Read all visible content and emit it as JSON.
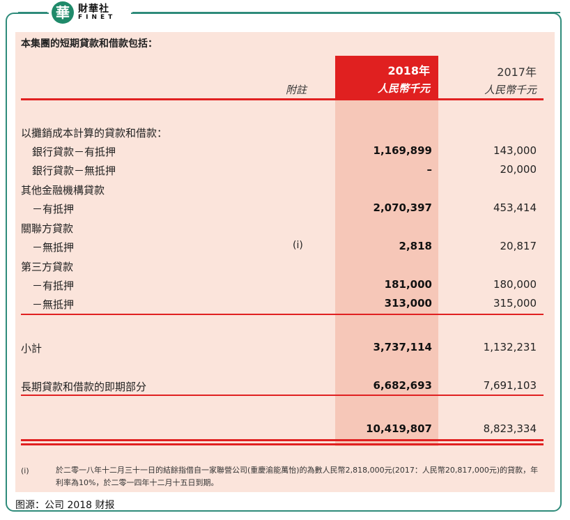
{
  "logo": {
    "mark": "華",
    "name_cn": "財華社",
    "name_en": "FINET"
  },
  "intro": "本集團的短期貸款和借款包括：",
  "columns": {
    "note_header": "附註",
    "current": {
      "year": "2018年",
      "unit": "人民幣千元"
    },
    "prior": {
      "year": "2017年",
      "unit": "人民幣千元"
    }
  },
  "rows": [
    {
      "label": "以攤銷成本計算的貸款和借款：",
      "note": "",
      "v2018": "",
      "v2017": ""
    },
    {
      "label": "銀行貸款－有抵押",
      "note": "",
      "v2018": "1,169,899",
      "v2017": "143,000"
    },
    {
      "label": "銀行貸款－無抵押",
      "note": "",
      "v2018": "–",
      "v2017": "20,000"
    },
    {
      "label": "其他金融機構貸款",
      "note": "",
      "v2018": "",
      "v2017": ""
    },
    {
      "label": "－有抵押",
      "note": "",
      "v2018": "2,070,397",
      "v2017": "453,414"
    },
    {
      "label": "關聯方貸款",
      "note": "",
      "v2018": "",
      "v2017": ""
    },
    {
      "label": "－無抵押",
      "note": "(i)",
      "v2018": "2,818",
      "v2017": "20,817"
    },
    {
      "label": "第三方貸款",
      "note": "",
      "v2018": "",
      "v2017": ""
    },
    {
      "label": "－有抵押",
      "note": "",
      "v2018": "181,000",
      "v2017": "180,000"
    },
    {
      "label": "－無抵押",
      "note": "",
      "v2018": "313,000",
      "v2017": "315,000"
    }
  ],
  "subtotal": {
    "label": "小計",
    "v2018": "3,737,114",
    "v2017": "1,132,231"
  },
  "current_portion": {
    "label": "長期貸款和借款的即期部分",
    "v2018": "6,682,693",
    "v2017": "7,691,103"
  },
  "total": {
    "v2018": "10,419,807",
    "v2017": "8,823,334"
  },
  "footnote": {
    "marker": "(i)",
    "text": "於二零一八年十二月三十一日的結餘指借自一家聯營公司(重慶渝能萬怡)的為數人民幣2,818,000元(2017：人民幣20,817,000元)的貸款，年利率為10%，於二零一四年十二月十五日到期。"
  },
  "source": "图源：公司 2018 财报",
  "colors": {
    "accent_red": "#e02020",
    "frame_green": "#2e8b7a",
    "panel_bg": "#fbe4db"
  }
}
